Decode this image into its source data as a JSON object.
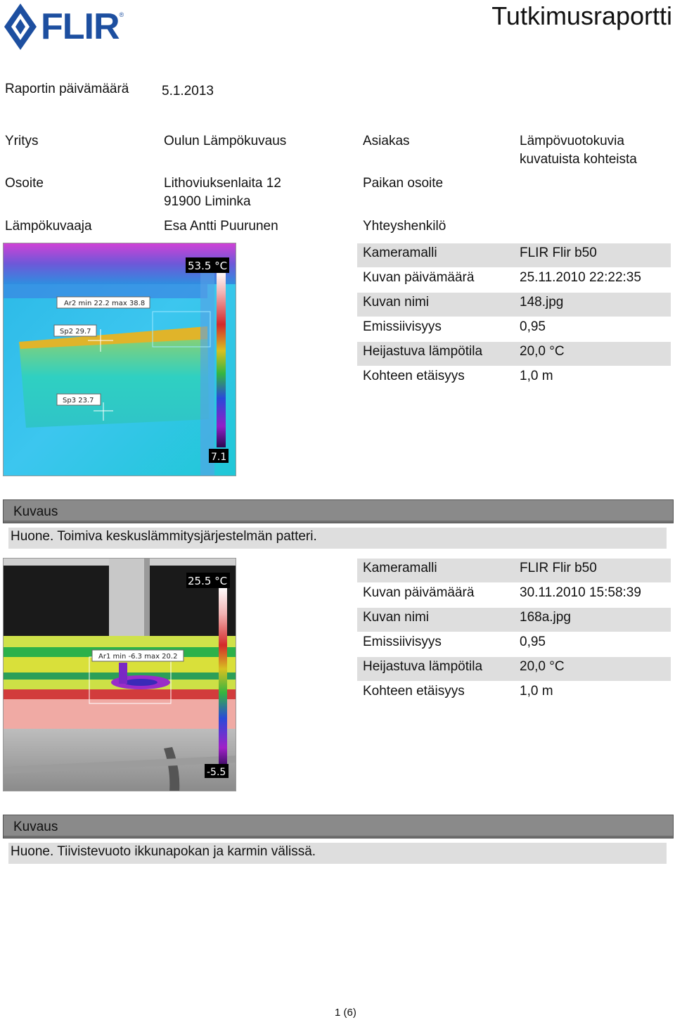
{
  "header": {
    "logo_text": "FLIR",
    "title": "Tutkimusraportti"
  },
  "report_date": {
    "label": "Raportin päivämäärä",
    "value": "5.1.2013"
  },
  "info": {
    "company_label": "Yritys",
    "company_value": "Oulun Lämpökuvaus",
    "client_label": "Asiakas",
    "client_value_line1": "Lämpövuotokuvia",
    "client_value_line2": "kuvatuista kohteista",
    "address_label": "Osoite",
    "address_line1": "Lithoviuksenlaita 12",
    "address_line2": "91900 Liminka",
    "site_label": "Paikan osoite",
    "thermographer_label": "Lämpökuvaaja",
    "thermographer_value": "Esa Antti Puurunen",
    "contact_label": "Yhteyshenkilö"
  },
  "images": [
    {
      "max_label": "53.5 °C",
      "min_label": "7.1",
      "ar_label": "Ar2 min 22.2 max 38.8",
      "sp2_label": "Sp2 29.7",
      "sp3_label": "Sp3 23.7",
      "rows": [
        {
          "label": "Kameramalli",
          "value": "FLIR Flir b50"
        },
        {
          "label": "Kuvan päivämäärä",
          "value": "25.11.2010 22:22:35"
        },
        {
          "label": "Kuvan nimi",
          "value": "148.jpg"
        },
        {
          "label": "Emissiivisyys",
          "value": "0,95"
        },
        {
          "label": "Heijastuva lämpötila",
          "value": "20,0 °C"
        },
        {
          "label": "Kohteen etäisyys",
          "value": "1,0 m"
        }
      ],
      "desc_heading": "Kuvaus",
      "desc_text": "Huone. Toimiva keskuslämmitysjärjestelmän patteri."
    },
    {
      "max_label": "25.5 °C",
      "min_label": "-5.5",
      "ar_label": "Ar1 min -6.3 max 20.2",
      "rows": [
        {
          "label": "Kameramalli",
          "value": "FLIR Flir b50"
        },
        {
          "label": "Kuvan päivämäärä",
          "value": "30.11.2010 15:58:39"
        },
        {
          "label": "Kuvan nimi",
          "value": "168a.jpg"
        },
        {
          "label": "Emissiivisyys",
          "value": "0,95"
        },
        {
          "label": "Heijastuva lämpötila",
          "value": "20,0 °C"
        },
        {
          "label": "Kohteen etäisyys",
          "value": "1,0 m"
        }
      ],
      "desc_heading": "Kuvaus",
      "desc_text": "Huone. Tiivistevuoto ikkunapokan ja karmin välissä."
    }
  ],
  "footer": {
    "page": "1 (6)"
  },
  "colors": {
    "brand_blue": "#1d4fa0",
    "row_shade": "#dedede",
    "desc_header": "#8a8a8a"
  }
}
